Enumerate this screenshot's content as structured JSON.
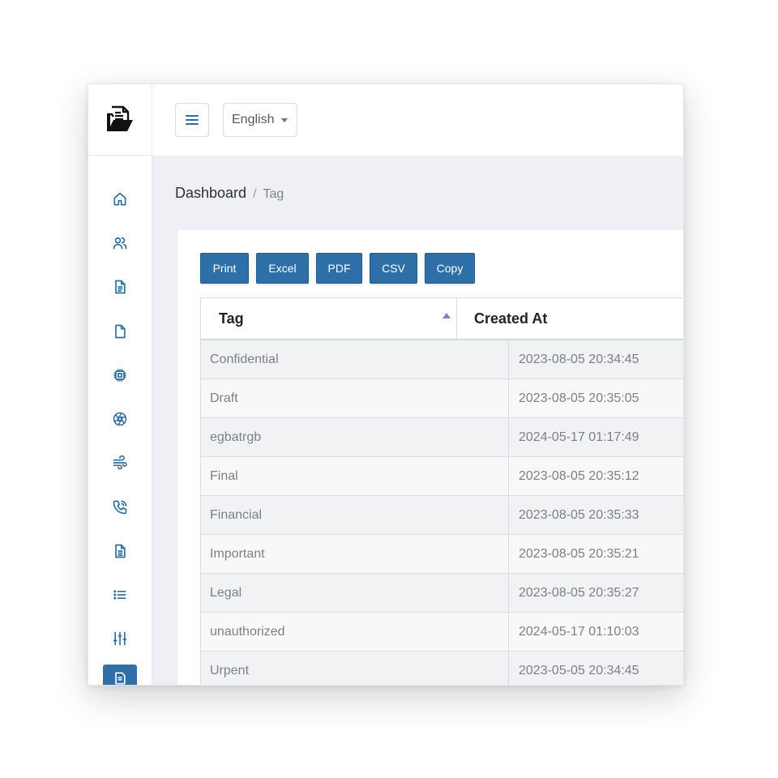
{
  "topbar": {
    "language": "English"
  },
  "breadcrumb": {
    "root": "Dashboard",
    "separator": "/",
    "current": "Tag"
  },
  "export_buttons": [
    {
      "label": "Print"
    },
    {
      "label": "Excel"
    },
    {
      "label": "PDF"
    },
    {
      "label": "CSV"
    },
    {
      "label": "Copy"
    }
  ],
  "table": {
    "columns": [
      "Tag",
      "Created At"
    ],
    "sort": {
      "column": "Tag",
      "direction": "asc"
    },
    "rows": [
      {
        "tag": "Confidential",
        "created_at": "2023-08-05 20:34:45"
      },
      {
        "tag": "Draft",
        "created_at": "2023-08-05 20:35:05"
      },
      {
        "tag": "egbatrgb",
        "created_at": "2024-05-17 01:17:49"
      },
      {
        "tag": "Final",
        "created_at": "2023-08-05 20:35:12"
      },
      {
        "tag": "Financial",
        "created_at": "2023-08-05 20:35:33"
      },
      {
        "tag": "Important",
        "created_at": "2023-08-05 20:35:21"
      },
      {
        "tag": "Legal",
        "created_at": "2023-08-05 20:35:27"
      },
      {
        "tag": "unauthorized",
        "created_at": "2024-05-17 01:10:03"
      },
      {
        "tag": "Urpent",
        "created_at": "2023-05-05 20:34:45"
      }
    ]
  },
  "sidebar": {
    "items": [
      {
        "icon": "home-icon"
      },
      {
        "icon": "users-icon"
      },
      {
        "icon": "document-text-icon"
      },
      {
        "icon": "file-icon"
      },
      {
        "icon": "cpu-chip-icon"
      },
      {
        "icon": "aperture-icon"
      },
      {
        "icon": "wind-icon"
      },
      {
        "icon": "phone-icon"
      },
      {
        "icon": "document-list-icon"
      },
      {
        "icon": "list-icon"
      },
      {
        "icon": "sliders-icon"
      },
      {
        "icon": "tag-page-icon",
        "active": true
      }
    ]
  },
  "colors": {
    "primary": "#2d6fa6",
    "icon": "#2e6d9c",
    "page_bg": "#eef0f5",
    "sort_arrow": "#7c86c0"
  }
}
